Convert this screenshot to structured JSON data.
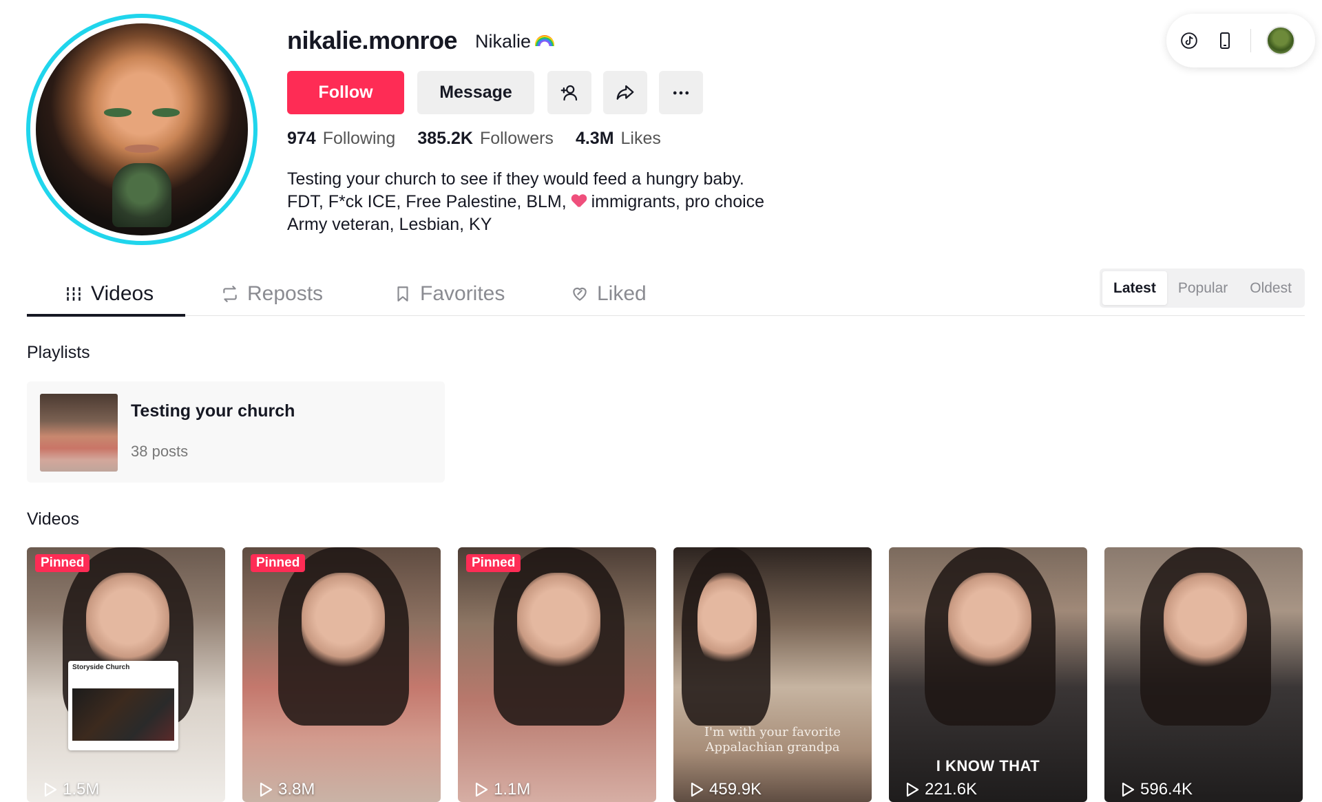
{
  "profile": {
    "username": "nikalie.monroe",
    "nickname": "Nikalie",
    "nickname_emoji": "rainbow-icon",
    "buttons": {
      "follow": "Follow",
      "message": "Message"
    },
    "stats": {
      "following_count": "974",
      "following_label": "Following",
      "followers_count": "385.2K",
      "followers_label": "Followers",
      "likes_count": "4.3M",
      "likes_label": "Likes"
    },
    "bio": {
      "line1": "Testing your church to see if they would feed a hungry baby.",
      "line2_before": "FDT, F*ck ICE, Free Palestine, BLM,",
      "line2_after": "immigrants, pro choice",
      "line3": "Army veteran, Lesbian, KY"
    }
  },
  "colors": {
    "accent": "#fe2c55",
    "avatar_ring": "#20d5ec",
    "text": "#161823",
    "muted": "#8a8b91"
  },
  "tabs": [
    {
      "label": "Videos",
      "icon": "grid-icon",
      "active": true
    },
    {
      "label": "Reposts",
      "icon": "repost-icon",
      "active": false
    },
    {
      "label": "Favorites",
      "icon": "bookmark-icon",
      "active": false
    },
    {
      "label": "Liked",
      "icon": "heart-icon",
      "active": false
    }
  ],
  "sort": {
    "options": [
      "Latest",
      "Popular",
      "Oldest"
    ],
    "selected": "Latest"
  },
  "playlists": {
    "title": "Playlists",
    "items": [
      {
        "name": "Testing your church",
        "count": "38 posts"
      }
    ]
  },
  "videos": {
    "title": "Videos",
    "pinned_label": "Pinned",
    "items": [
      {
        "views": "1.5M",
        "pinned": true,
        "overlay": "Storyside Church"
      },
      {
        "views": "3.8M",
        "pinned": true,
        "overlay": ""
      },
      {
        "views": "1.1M",
        "pinned": true,
        "overlay": ""
      },
      {
        "views": "459.9K",
        "pinned": false,
        "overlay": "I'm with your favorite Appalachian grandpa"
      },
      {
        "views": "221.6K",
        "pinned": false,
        "overlay": "I KNOW THAT"
      },
      {
        "views": "596.4K",
        "pinned": false,
        "overlay": ""
      }
    ]
  }
}
